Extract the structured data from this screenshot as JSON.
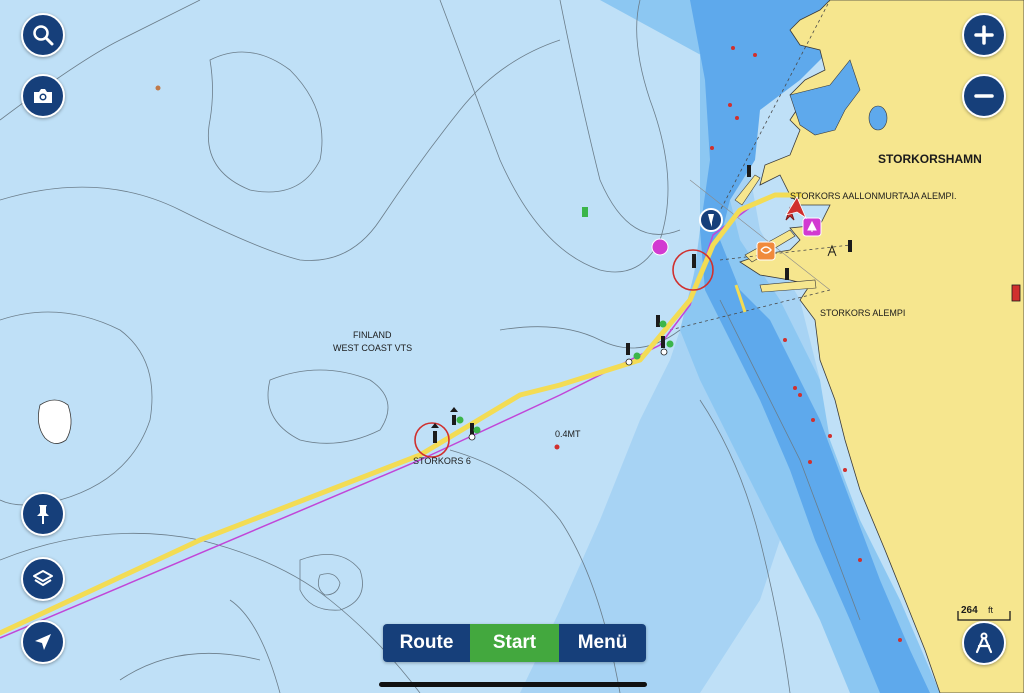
{
  "map": {
    "labels": {
      "storkorshamn": "STORKORSHAMN",
      "aallonmurtaja": "STORKORS AALLONMURTAJA ALEMPI.",
      "storkors_alempi": "STORKORS ALEMPI",
      "finland": "FINLAND",
      "west_coast_vts": "WEST COAST VTS",
      "storkors6": "STORKORS 6",
      "depth_04mt": "0.4MT"
    },
    "colors": {
      "shallow_water": "#bfe0f7",
      "mid_water": "#9fd0f3",
      "deep_channel": "#5ea9ec",
      "land": "#f6e68e",
      "track": "#f3dc54",
      "route_line": "#c146d8",
      "marker_magenta": "#d23ad1",
      "marker_orange": "#f08a3c"
    }
  },
  "left_controls": {
    "search": {
      "icon": "search-icon"
    },
    "screenshot": {
      "icon": "camera-icon"
    },
    "waypoint": {
      "icon": "pin-icon"
    },
    "layers": {
      "icon": "layers-icon"
    },
    "locate": {
      "icon": "navigation-arrow-icon"
    }
  },
  "right_controls": {
    "zoom_in": {
      "icon": "plus-icon"
    },
    "zoom_out": {
      "icon": "minus-icon"
    },
    "measure": {
      "icon": "compass-divider-icon"
    }
  },
  "toolbar": {
    "route_label": "Route",
    "start_label": "Start",
    "menu_label": "Menü"
  },
  "scale": {
    "value": "264",
    "unit": "ft"
  }
}
